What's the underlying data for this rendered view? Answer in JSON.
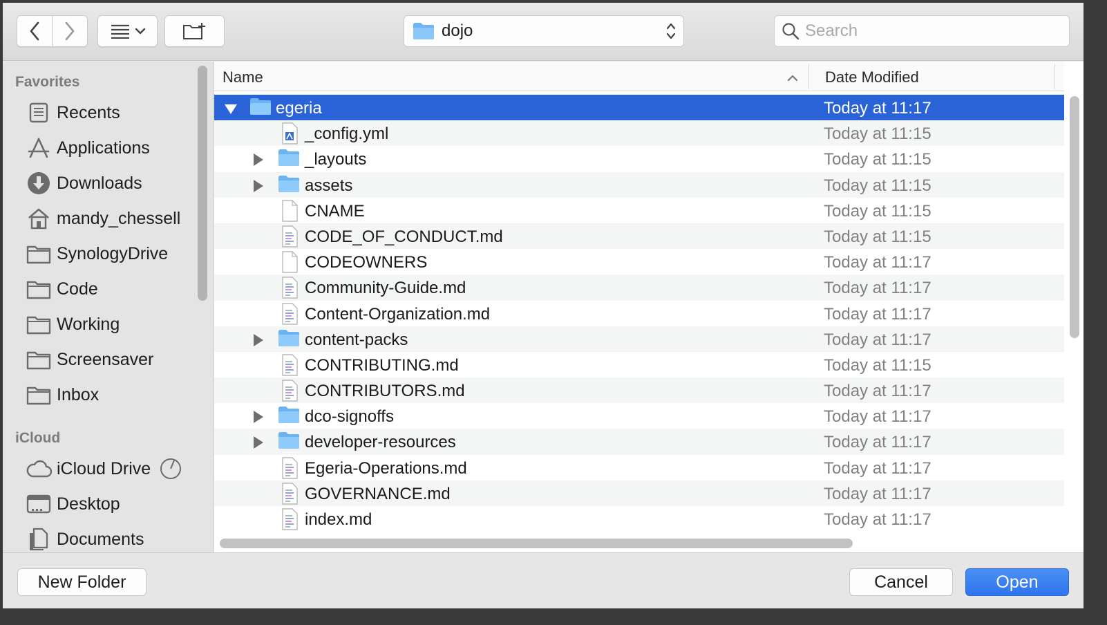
{
  "toolbar": {
    "path_label": "dojo",
    "search_placeholder": "Search"
  },
  "sidebar": {
    "favorites_title": "Favorites",
    "favorites": [
      {
        "label": "Recents",
        "icon": "recents-icon"
      },
      {
        "label": "Applications",
        "icon": "applications-icon"
      },
      {
        "label": "Downloads",
        "icon": "downloads-icon"
      },
      {
        "label": "mandy_chessell",
        "icon": "home-icon"
      },
      {
        "label": "SynologyDrive",
        "icon": "folder-icon"
      },
      {
        "label": "Code",
        "icon": "folder-icon"
      },
      {
        "label": "Working",
        "icon": "folder-icon"
      },
      {
        "label": "Screensaver",
        "icon": "folder-icon"
      },
      {
        "label": "Inbox",
        "icon": "folder-icon"
      }
    ],
    "icloud_title": "iCloud",
    "icloud": [
      {
        "label": "iCloud Drive",
        "icon": "cloud-icon"
      },
      {
        "label": "Desktop",
        "icon": "desktop-icon"
      },
      {
        "label": "Documents",
        "icon": "documents-icon"
      }
    ]
  },
  "columns": {
    "name": "Name",
    "date": "Date Modified"
  },
  "files": [
    {
      "name": "egeria",
      "date": "Today at 11:17",
      "kind": "folder",
      "level": 0,
      "expanded": true,
      "selected": true
    },
    {
      "name": "_config.yml",
      "date": "Today at 11:15",
      "kind": "yml",
      "level": 1
    },
    {
      "name": "_layouts",
      "date": "Today at 11:15",
      "kind": "folder",
      "level": 1
    },
    {
      "name": "assets",
      "date": "Today at 11:15",
      "kind": "folder",
      "level": 1
    },
    {
      "name": "CNAME",
      "date": "Today at 11:15",
      "kind": "blank",
      "level": 1
    },
    {
      "name": "CODE_OF_CONDUCT.md",
      "date": "Today at 11:15",
      "kind": "text",
      "level": 1
    },
    {
      "name": "CODEOWNERS",
      "date": "Today at 11:17",
      "kind": "blank",
      "level": 1
    },
    {
      "name": "Community-Guide.md",
      "date": "Today at 11:17",
      "kind": "text",
      "level": 1
    },
    {
      "name": "Content-Organization.md",
      "date": "Today at 11:17",
      "kind": "text",
      "level": 1
    },
    {
      "name": "content-packs",
      "date": "Today at 11:17",
      "kind": "folder",
      "level": 1
    },
    {
      "name": "CONTRIBUTING.md",
      "date": "Today at 11:15",
      "kind": "text",
      "level": 1
    },
    {
      "name": "CONTRIBUTORS.md",
      "date": "Today at 11:17",
      "kind": "text",
      "level": 1
    },
    {
      "name": "dco-signoffs",
      "date": "Today at 11:17",
      "kind": "folder",
      "level": 1
    },
    {
      "name": "developer-resources",
      "date": "Today at 11:17",
      "kind": "folder",
      "level": 1
    },
    {
      "name": "Egeria-Operations.md",
      "date": "Today at 11:17",
      "kind": "text",
      "level": 1
    },
    {
      "name": "GOVERNANCE.md",
      "date": "Today at 11:17",
      "kind": "text",
      "level": 1
    },
    {
      "name": "index.md",
      "date": "Today at 11:17",
      "kind": "text",
      "level": 1
    }
  ],
  "buttons": {
    "new_folder": "New Folder",
    "cancel": "Cancel",
    "open": "Open"
  }
}
